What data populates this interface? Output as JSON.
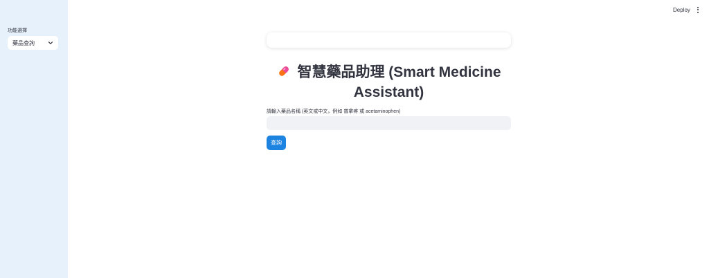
{
  "sidebar": {
    "select_label": "功能選擇",
    "select_value": "藥品查詢",
    "chevron_icon": "chevron-down-icon",
    "background": "#e6f1fb"
  },
  "topbar": {
    "deploy_label": "Deploy",
    "menu_icon": "more-vertical-icon"
  },
  "main": {
    "title_icon": "pill-icon",
    "title": "智慧藥品助理 (Smart Medicine Assistant)",
    "input_label": "請輸入藥品名稱 (英文或中文，例如 普拿疼 或 acetaminophen)",
    "input_value": "",
    "query_button": "查詢",
    "accent": "#1c83e1"
  }
}
